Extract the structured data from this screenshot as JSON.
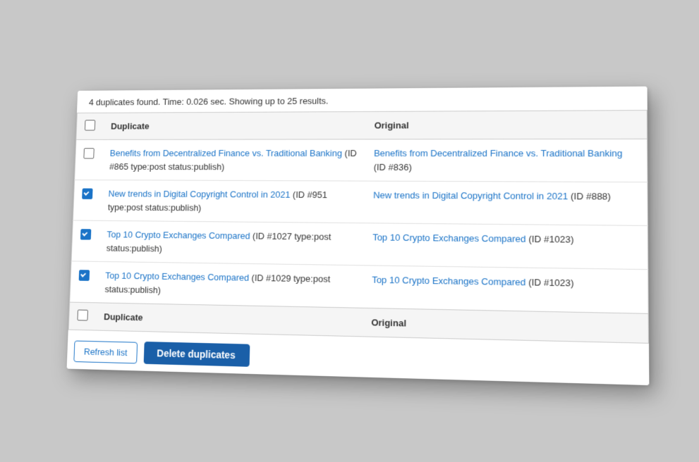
{
  "status_bar": {
    "text": "4 duplicates found. Time: 0.026 sec. Showing up to 25 results."
  },
  "table": {
    "header": {
      "duplicate_label": "Duplicate",
      "original_label": "Original"
    },
    "footer": {
      "duplicate_label": "Duplicate",
      "original_label": "Original"
    },
    "rows": [
      {
        "checked": false,
        "duplicate_link": "Benefits from Decentralized Finance vs. Traditional Banking",
        "duplicate_meta": " (ID #865 type:post status:publish)",
        "original_link": "Benefits from Decentralized Finance vs. Traditional Banking",
        "original_meta": " (ID #836)"
      },
      {
        "checked": true,
        "duplicate_link": "New trends in Digital Copyright Control in 2021",
        "duplicate_meta": " (ID #951 type:post status:publish)",
        "original_link": "New trends in Digital Copyright Control in 2021",
        "original_meta": " (ID #888)"
      },
      {
        "checked": true,
        "duplicate_link": "Top 10 Crypto Exchanges Compared",
        "duplicate_meta": " (ID #1027 type:post status:publish)",
        "original_link": "Top 10 Crypto Exchanges Compared",
        "original_meta": " (ID #1023)"
      },
      {
        "checked": true,
        "duplicate_link": "Top 10 Crypto Exchanges Compared",
        "duplicate_meta": " (ID #1029 type:post status:publish)",
        "original_link": "Top 10 Crypto Exchanges Compared",
        "original_meta": " (ID #1023)"
      }
    ]
  },
  "buttons": {
    "refresh_label": "Refresh list",
    "delete_label": "Delete duplicates"
  }
}
